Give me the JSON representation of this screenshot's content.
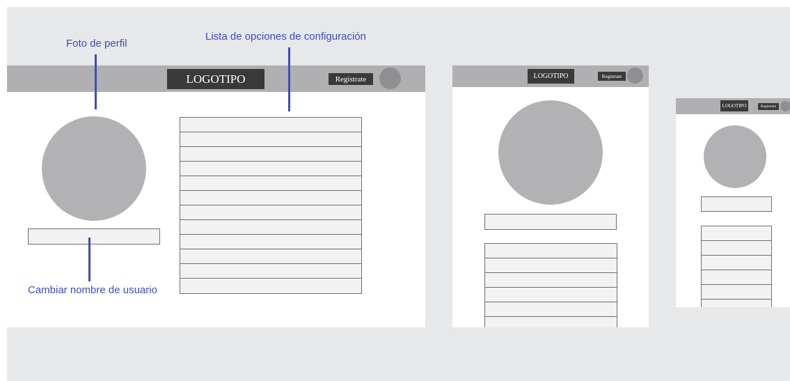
{
  "annotations": {
    "profile_photo": "Foto de perfil",
    "settings_list": "Lista de opciones de configuración",
    "change_username": "Cambiar nombre de usuario"
  },
  "header": {
    "logo": "LOGOTIPO",
    "register": "Registrate"
  },
  "colors": {
    "annotation": "#3b4cc0",
    "header": "#b0b0b2",
    "dark": "#3a3a3a",
    "placeholder": "#b2b2b4",
    "background": "#e7e8ea"
  },
  "icons": [
    "user-avatar-icon"
  ]
}
